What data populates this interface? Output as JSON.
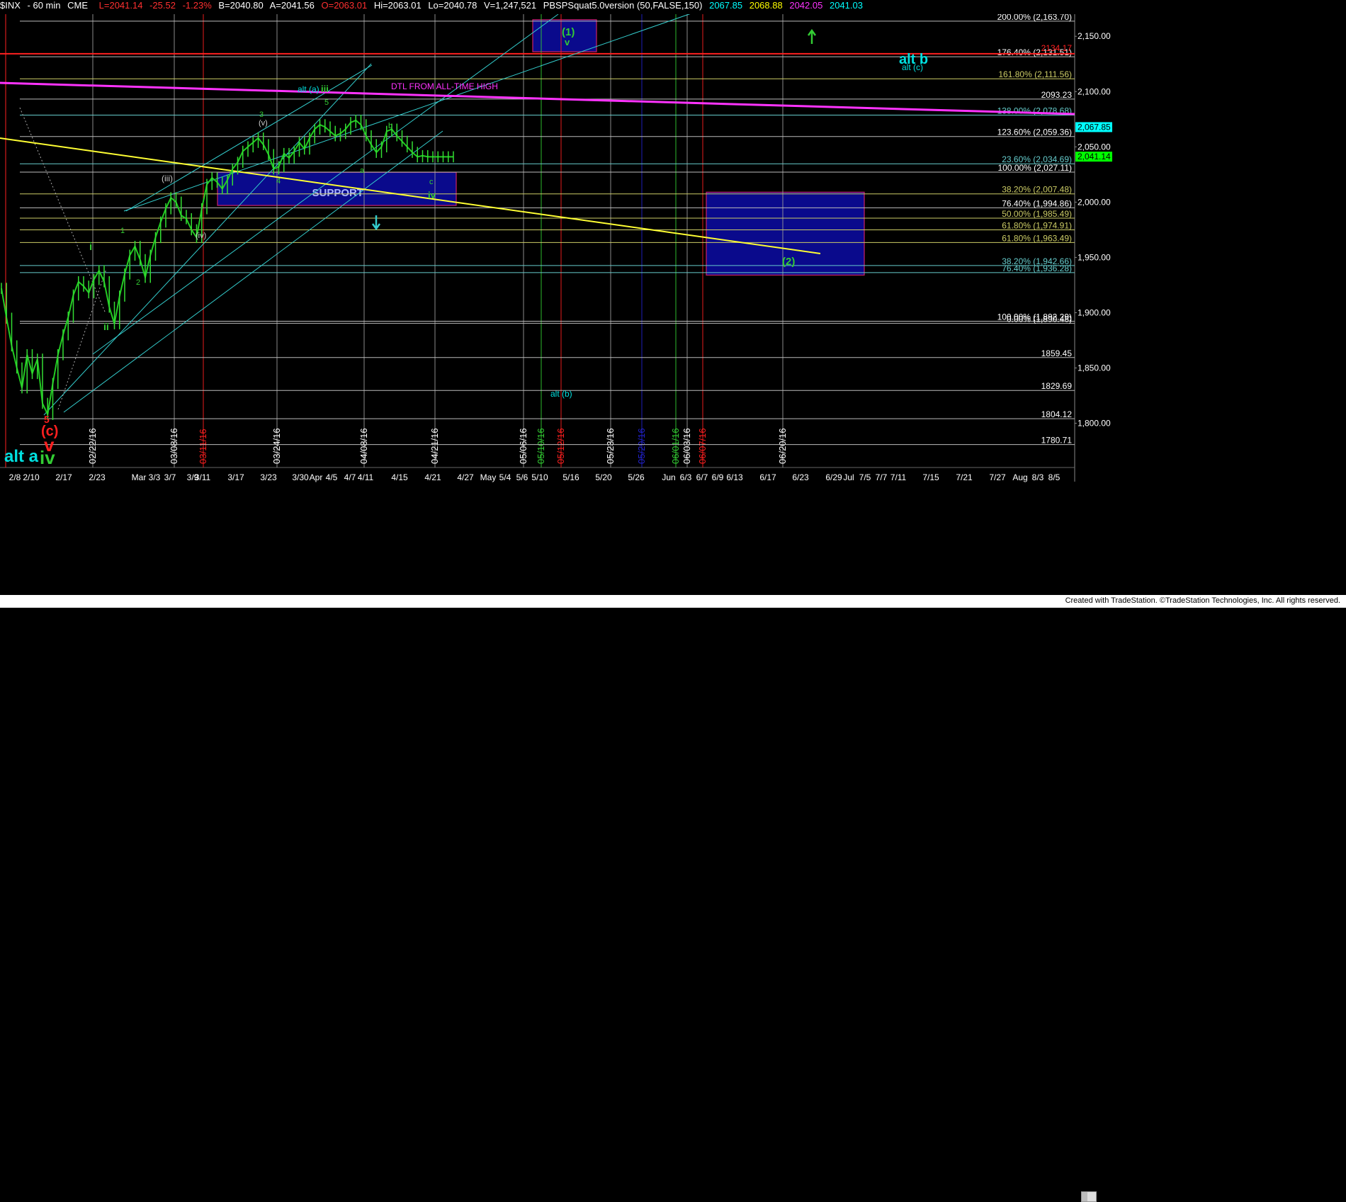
{
  "header": {
    "symbol": "$INX",
    "interval": "60 min",
    "exchange": "CME",
    "last": "L=2041.14",
    "change": "-25.52",
    "change_pct": "-1.23%",
    "bid": "B=2040.80",
    "ask": "A=2041.56",
    "open": "O=2063.01",
    "high": "Hi=2063.01",
    "low": "Lo=2040.78",
    "volume": "V=1,247,521",
    "indicator": "PBSPSquat5.0version (50,FALSE,150)",
    "ind_values": [
      "2067.85",
      "2068.88",
      "2042.05",
      "2041.03"
    ]
  },
  "footer": {
    "credit": "Created with TradeStation. ©TradeStation Technologies, Inc. All rights reserved."
  },
  "chart_data": {
    "type": "line",
    "title": "",
    "ylim": [
      1760,
      2170
    ],
    "y_ticks": [
      "2,150.00",
      "2,100.00",
      "2,050.00",
      "2,000.00",
      "1,950.00",
      "1,900.00",
      "1,850.00",
      "1,800.00"
    ],
    "current_price_labels": [
      {
        "value": 2067.85,
        "label": "2,067.85",
        "color": "#00ffff"
      },
      {
        "value": 2041.14,
        "label": "2,041.14",
        "color": "#00ff00"
      }
    ],
    "x_date_labels": [
      "2/8",
      "2/10",
      "2/17",
      "2/23",
      "Mar",
      "3/3",
      "3/7",
      "3/9",
      "3/11",
      "3/17",
      "3/23",
      "3/30",
      "Apr",
      "4/5",
      "4/7",
      "4/11",
      "4/15",
      "4/21",
      "4/27",
      "May",
      "5/4",
      "5/6",
      "5/10",
      "5/16",
      "5/20",
      "5/26",
      "Jun",
      "6/3",
      "6/7",
      "6/9",
      "6/13",
      "6/17",
      "6/23",
      "6/29",
      "Jul",
      "7/5",
      "7/7",
      "7/11",
      "7/15",
      "7/21",
      "7/27",
      "Aug",
      "8/3",
      "8/5"
    ],
    "vertical_date_labels": [
      {
        "text": "02/22/16",
        "color": "#ffffff"
      },
      {
        "text": "03/08/16",
        "color": "#ffffff"
      },
      {
        "text": "03/11/16",
        "color": "#ff2020"
      },
      {
        "text": "03/24/16",
        "color": "#ffffff"
      },
      {
        "text": "04/08/16",
        "color": "#ffffff"
      },
      {
        "text": "04/21/16",
        "color": "#ffffff"
      },
      {
        "text": "05/06/16",
        "color": "#ffffff"
      },
      {
        "text": "05/10/16",
        "color": "#33cc33"
      },
      {
        "text": "05/12/16",
        "color": "#ff2020"
      },
      {
        "text": "05/23/16",
        "color": "#ffffff"
      },
      {
        "text": "05/29/16",
        "color": "#2222cc"
      },
      {
        "text": "06/01/16",
        "color": "#33cc33"
      },
      {
        "text": "06/03/16",
        "color": "#ffffff"
      },
      {
        "text": "06/07/16",
        "color": "#ff2020"
      },
      {
        "text": "06/20/16",
        "color": "#ffffff"
      }
    ],
    "fib_levels": [
      {
        "label": "200.00% (2,163.70)",
        "value": 2163.7,
        "color": "#ffffff"
      },
      {
        "label": "176.40% (2,131.51)",
        "value": 2131.51,
        "color": "#ffffff"
      },
      {
        "label": "161.80% (2,111.56)",
        "value": 2111.56,
        "color": "#cccc66"
      },
      {
        "label": "2093.23",
        "value": 2093.23,
        "color": "#ffffff"
      },
      {
        "label": "138.00% (2,078.68)",
        "value": 2078.68,
        "color": "#66cccc"
      },
      {
        "label": "123.60% (2,059.36)",
        "value": 2059.36,
        "color": "#ffffff"
      },
      {
        "label": "23.60% (2,034.69)",
        "value": 2034.69,
        "color": "#66cccc"
      },
      {
        "label": "100.00% (2,027.11)",
        "value": 2027.11,
        "color": "#ffffff"
      },
      {
        "label": "38.20% (2,007.48)",
        "value": 2007.48,
        "color": "#cccc66"
      },
      {
        "label": "76.40% (1,994.86)",
        "value": 1994.86,
        "color": "#ffffff"
      },
      {
        "label": "50.00% (1,985.49)",
        "value": 1985.49,
        "color": "#cccc66"
      },
      {
        "label": "61.80% (1,974.91)",
        "value": 1974.91,
        "color": "#cccc66"
      },
      {
        "label": "61.80% (1,963.49)",
        "value": 1963.49,
        "color": "#cccc66"
      },
      {
        "label": "38.20% (1,942.66)",
        "value": 1942.66,
        "color": "#66cccc"
      },
      {
        "label": "76.40% (1,936.28)",
        "value": 1936.28,
        "color": "#66cccc"
      },
      {
        "label": "100.00% (1,892.29)",
        "value": 1892.29,
        "color": "#ffffff"
      },
      {
        "label": "0.00% (1,890.48)",
        "value": 1890.48,
        "color": "#ffffff"
      },
      {
        "label": "1859.45",
        "value": 1859.45,
        "color": "#ffffff"
      },
      {
        "label": "1829.69",
        "value": 1829.69,
        "color": "#ffffff"
      },
      {
        "label": "1804.12",
        "value": 1804.12,
        "color": "#ffffff"
      },
      {
        "label": "1780.71",
        "value": 1780.71,
        "color": "#ffffff"
      }
    ],
    "red_level": {
      "label": "2134.17",
      "value": 2134.17
    },
    "trendlines": [
      {
        "label": "DTL FROM ALL-TIME HIGH",
        "color": "#ff33ff"
      }
    ],
    "zones": [
      {
        "label": "SUPPORT",
        "y_range": [
          1997,
          2027
        ]
      },
      {
        "label": "",
        "y_range": [
          2136,
          2165
        ]
      },
      {
        "label": "",
        "y_range": [
          1934,
          2009
        ]
      }
    ],
    "wave_labels": [
      {
        "text": "5",
        "color": "#ff2020"
      },
      {
        "text": "(c)",
        "color": "#ff2020"
      },
      {
        "text": "v",
        "color": "#ff2020"
      },
      {
        "text": "alt a",
        "color": "#00e0e0"
      },
      {
        "text": "iv",
        "color": "#33cc33"
      },
      {
        "text": "i",
        "color": "#33cc33"
      },
      {
        "text": "ii",
        "color": "#33cc33"
      },
      {
        "text": "1",
        "color": "#33cc33"
      },
      {
        "text": "2",
        "color": "#33cc33"
      },
      {
        "text": "(iii)",
        "color": "#cccccc"
      },
      {
        "text": "(iv)",
        "color": "#cccccc"
      },
      {
        "text": "3",
        "color": "#33cc33"
      },
      {
        "text": "(v)",
        "color": "#cccccc"
      },
      {
        "text": "4",
        "color": "#33cc33"
      },
      {
        "text": "5",
        "color": "#33cc33"
      },
      {
        "text": "alt (a)",
        "color": "#00e0e0"
      },
      {
        "text": "iii",
        "color": "#33cc33"
      },
      {
        "text": "a",
        "color": "#33cc33"
      },
      {
        "text": "b",
        "color": "#33cc33"
      },
      {
        "text": "c",
        "color": "#33cc33"
      },
      {
        "text": "iv",
        "color": "#33cc33"
      },
      {
        "text": "(1)",
        "color": "#33cc33"
      },
      {
        "text": "v",
        "color": "#33cc33"
      },
      {
        "text": "(2)",
        "color": "#33cc33"
      },
      {
        "text": "alt (b)",
        "color": "#00e0e0"
      },
      {
        "text": "alt b",
        "color": "#00e0e0"
      },
      {
        "text": "alt (c)",
        "color": "#00e0e0"
      }
    ],
    "price_series": {
      "x_days": [
        0,
        0.5,
        1,
        1.5,
        2,
        2.5,
        3,
        3.5,
        4,
        4.5,
        5,
        5.5,
        6,
        6.5,
        7,
        7.5,
        8,
        8.5,
        9,
        9.5,
        10,
        10.5,
        11,
        11.5,
        12,
        12.5,
        13,
        13.5,
        14,
        14.5,
        15,
        15.5,
        16,
        16.5,
        17,
        17.5,
        18,
        18.5,
        19,
        19.5,
        20,
        20.5,
        21,
        21.5,
        22,
        22.5,
        23,
        23.5,
        24,
        24.5,
        25,
        25.5,
        26,
        26.5,
        27,
        27.5,
        28,
        28.5,
        29,
        29.5,
        30,
        30.5,
        31,
        31.5,
        32,
        32.5,
        33,
        33.5,
        34,
        34.5,
        35,
        35.5,
        36,
        36.5,
        37,
        37.5,
        38,
        38.5,
        39,
        39.5,
        40,
        40.5,
        41,
        41.5,
        42,
        42.5,
        43,
        43.5,
        44
      ],
      "close": [
        1922,
        1895,
        1870,
        1850,
        1832,
        1862,
        1845,
        1858,
        1818,
        1808,
        1836,
        1862,
        1880,
        1896,
        1916,
        1928,
        1924,
        1918,
        1930,
        1938,
        1928,
        1905,
        1890,
        1915,
        1935,
        1952,
        1960,
        1948,
        1932,
        1952,
        1968,
        1982,
        1994,
        2004,
        2000,
        1988,
        1985,
        1975,
        1968,
        1994,
        2016,
        2022,
        2018,
        2012,
        2020,
        2030,
        2036,
        2046,
        2050,
        2054,
        2058,
        2052,
        2043,
        2030,
        2032,
        2044,
        2040,
        2046,
        2054,
        2048,
        2058,
        2066,
        2070,
        2068,
        2064,
        2060,
        2062,
        2066,
        2072,
        2074,
        2070,
        2060,
        2052,
        2045,
        2050,
        2064,
        2066,
        2060,
        2055,
        2050,
        2045,
        2041,
        2042,
        2041,
        2041,
        2041,
        2041,
        2041,
        2041
      ]
    }
  }
}
